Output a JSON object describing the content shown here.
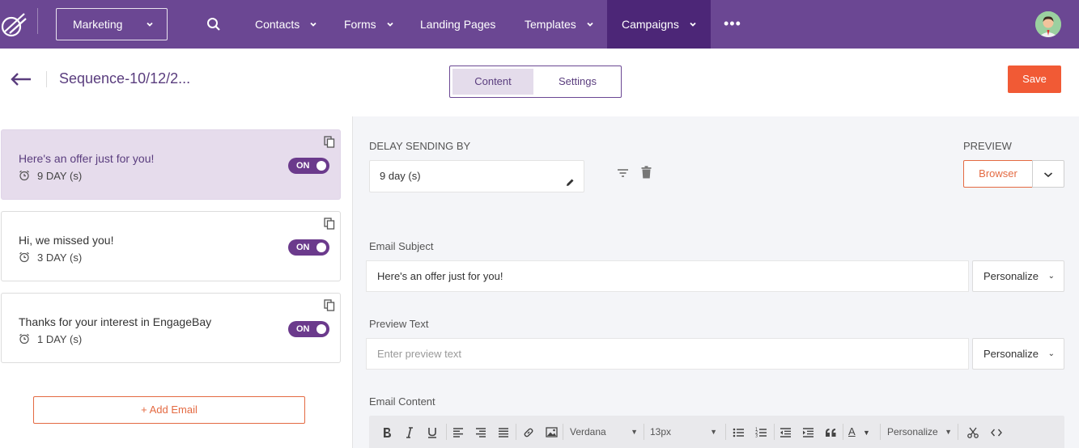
{
  "nav": {
    "workspace": "Marketing",
    "items": [
      "Contacts",
      "Forms",
      "Landing Pages",
      "Templates",
      "Campaigns"
    ],
    "active": "Campaigns",
    "more": "•••"
  },
  "header": {
    "title": "Sequence-10/12/2...",
    "tabs": [
      "Content",
      "Settings"
    ],
    "active_tab": "Content",
    "save_label": "Save"
  },
  "emails": [
    {
      "title": "Here's an offer just for you!",
      "delay": "9 DAY (s)",
      "toggle": "ON",
      "selected": true
    },
    {
      "title": "Hi, we missed you!",
      "delay": "3 DAY (s)",
      "toggle": "ON",
      "selected": false
    },
    {
      "title": "Thanks for your interest in EngageBay",
      "delay": "1 DAY (s)",
      "toggle": "ON",
      "selected": false
    }
  ],
  "add_email_label": "+ Add Email",
  "editor": {
    "delay_label": "DELAY SENDING BY",
    "delay_value": "9 day (s)",
    "preview_label": "PREVIEW",
    "preview_button": "Browser",
    "subject_label": "Email Subject",
    "subject_value": "Here's an offer just for you!",
    "preview_text_label": "Preview Text",
    "preview_text_placeholder": "Enter preview text",
    "personalize_label": "Personalize",
    "content_label": "Email Content"
  },
  "toolbar": {
    "font": "Verdana",
    "size": "13px",
    "personalize": "Personalize",
    "text_color_letter": "A"
  },
  "colors": {
    "nav_bg": "#6b4793",
    "nav_active": "#4c2677",
    "accent": "#f15a35",
    "selected_card": "#e6dcec",
    "toggle": "#6b3a8c"
  }
}
